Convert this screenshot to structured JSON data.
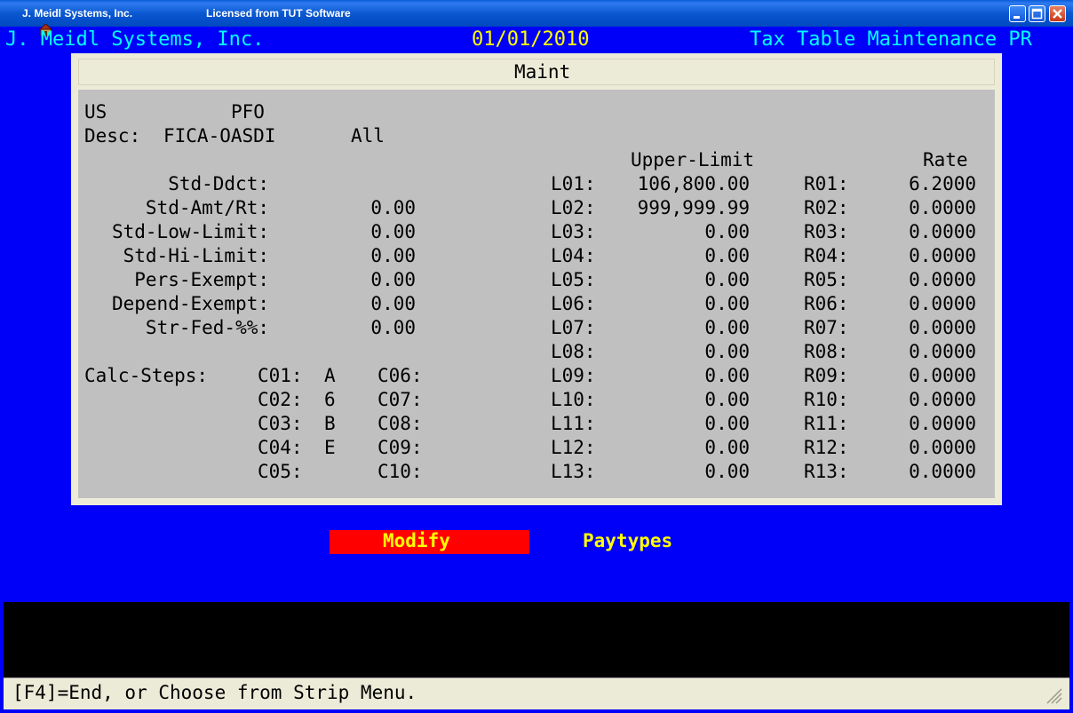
{
  "window": {
    "company": "J. Meidl Systems, Inc.",
    "license": "Licensed from TUT Software",
    "controls": [
      "minimize",
      "maximize",
      "close"
    ]
  },
  "header": {
    "company": "J. Meidl Systems, Inc.",
    "date": "01/01/2010",
    "module": "Tax Table Maintenance PR"
  },
  "panel": {
    "title": "Maint",
    "state": "US",
    "code": "PFO",
    "desc_label": "Desc:",
    "desc_value": "FICA-OASDI",
    "desc_scope": "All",
    "upper_limit_header": "Upper-Limit",
    "rate_header": "Rate",
    "fields": [
      {
        "label": "Std-Ddct:",
        "value": ""
      },
      {
        "label": "Std-Amt/Rt:",
        "value": "0.00"
      },
      {
        "label": "Std-Low-Limit:",
        "value": "0.00"
      },
      {
        "label": "Std-Hi-Limit:",
        "value": "0.00"
      },
      {
        "label": "Pers-Exempt:",
        "value": "0.00"
      },
      {
        "label": "Depend-Exempt:",
        "value": "0.00"
      },
      {
        "label": "Str-Fed-%%:",
        "value": "0.00"
      }
    ],
    "limits": [
      {
        "label": "L01:",
        "value": "106,800.00"
      },
      {
        "label": "L02:",
        "value": "999,999.99"
      },
      {
        "label": "L03:",
        "value": "0.00"
      },
      {
        "label": "L04:",
        "value": "0.00"
      },
      {
        "label": "L05:",
        "value": "0.00"
      },
      {
        "label": "L06:",
        "value": "0.00"
      },
      {
        "label": "L07:",
        "value": "0.00"
      },
      {
        "label": "L08:",
        "value": "0.00"
      },
      {
        "label": "L09:",
        "value": "0.00"
      },
      {
        "label": "L10:",
        "value": "0.00"
      },
      {
        "label": "L11:",
        "value": "0.00"
      },
      {
        "label": "L12:",
        "value": "0.00"
      },
      {
        "label": "L13:",
        "value": "0.00"
      }
    ],
    "rates": [
      {
        "label": "R01:",
        "value": "6.2000"
      },
      {
        "label": "R02:",
        "value": "0.0000"
      },
      {
        "label": "R03:",
        "value": "0.0000"
      },
      {
        "label": "R04:",
        "value": "0.0000"
      },
      {
        "label": "R05:",
        "value": "0.0000"
      },
      {
        "label": "R06:",
        "value": "0.0000"
      },
      {
        "label": "R07:",
        "value": "0.0000"
      },
      {
        "label": "R08:",
        "value": "0.0000"
      },
      {
        "label": "R09:",
        "value": "0.0000"
      },
      {
        "label": "R10:",
        "value": "0.0000"
      },
      {
        "label": "R11:",
        "value": "0.0000"
      },
      {
        "label": "R12:",
        "value": "0.0000"
      },
      {
        "label": "R13:",
        "value": "0.0000"
      }
    ],
    "calc_label": "Calc-Steps:",
    "calc_steps": [
      {
        "label": "C01:",
        "value": "A"
      },
      {
        "label": "C02:",
        "value": "6"
      },
      {
        "label": "C03:",
        "value": "B"
      },
      {
        "label": "C04:",
        "value": "E"
      },
      {
        "label": "C05:",
        "value": ""
      },
      {
        "label": "C06:",
        "value": ""
      },
      {
        "label": "C07:",
        "value": ""
      },
      {
        "label": "C08:",
        "value": ""
      },
      {
        "label": "C09:",
        "value": ""
      },
      {
        "label": "C10:",
        "value": ""
      }
    ]
  },
  "menu": {
    "items": [
      "Modify",
      "Paytypes"
    ],
    "selected": "Modify"
  },
  "status": "[F4]=End, or Choose from Strip Menu.",
  "colors": {
    "background": "#0000f8",
    "header_text": "#00ffff",
    "date_text": "#ffff00",
    "menu_text": "#ffff00",
    "menu_highlight": "#ff0000",
    "panel_body": "#c0c0c0",
    "panel_frame": "#ecebd8"
  }
}
